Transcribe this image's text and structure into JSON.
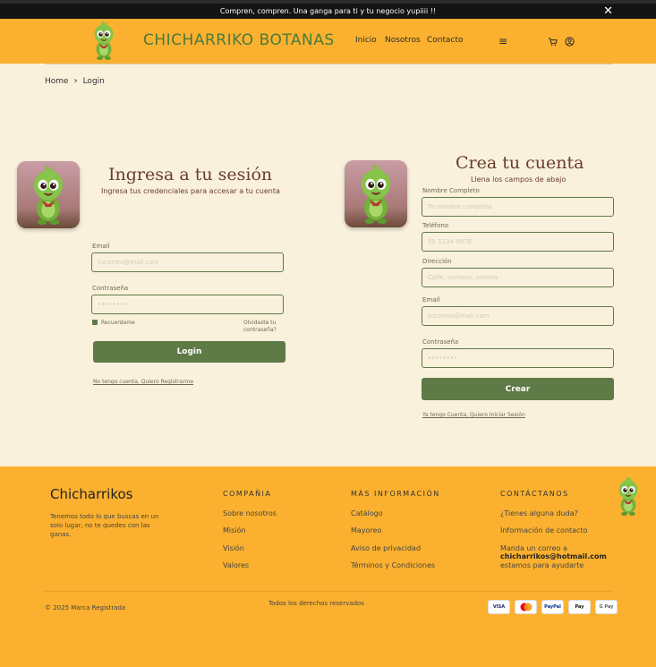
{
  "announcement": {
    "text": "Compren, compren. Una ganga para ti y tu negocio yupiiii !!",
    "close_icon": "close-icon"
  },
  "header": {
    "brand": "CHICHARRIKO BOTANAS",
    "nav": [
      "Inicio",
      "Nosotros",
      "Contacto"
    ],
    "icons": [
      "menu-icon",
      "cart-icon",
      "user-icon"
    ]
  },
  "breadcrumb": {
    "home": "Home",
    "current": "Login"
  },
  "login": {
    "title": "Ingresa a tu sesión",
    "subtitle": "Ingresa tus credenciales para accesar a tu cuenta",
    "email_label": "Email",
    "email_placeholder": "tucorreo@mail.com",
    "password_label": "Contraseña",
    "password_placeholder": "••••••••",
    "remember": "Recuerdame",
    "forgot": "Olvidaste tu contraseña?",
    "button": "Login",
    "no_account": "No tengo cuenta, Quiero Registrarme"
  },
  "register": {
    "title": "Crea tu cuenta",
    "subtitle": "Llena  los campos de abajo",
    "name_label": "Nombre Completo",
    "name_placeholder": "Tu nombre completo",
    "phone_label": "Teléfono",
    "phone_placeholder": "55 1234 5678",
    "address_label": "Dirección",
    "address_placeholder": "Calle, número, colonia",
    "email_label": "Email",
    "email_placeholder": "tucorreo@mail.com",
    "password_label": "Contraseña",
    "password_placeholder": "••••••••",
    "button": "Crear",
    "have_account": "Ya tengo Cuenta, Quiero Iniciar Sesión"
  },
  "footer": {
    "brand": "Chicharrikos",
    "tagline": "Tenemos todo lo que buscas en un solo lugar, no te quedes con las ganas.",
    "company": {
      "title": "COMPAÑIA",
      "items": [
        "Sobre nosotros",
        "Misión",
        "Visión",
        "Valores"
      ]
    },
    "more_info": {
      "title": "MÁS INFORMACIÓN",
      "items": [
        "Catálogo",
        "Mayoreo",
        "Aviso de privacidad",
        "Términos y Condiciones"
      ]
    },
    "contact": {
      "title": "CONTÁCTANOS",
      "items": [
        "¿Tienes alguna duda?",
        "Información de contacto"
      ],
      "mail_prefix": "Manda un correo a",
      "email": "chicharrikos@hotmail.com",
      "mail_suffix": "estamos para ayudarte"
    },
    "copyright": "© 2025 Marca Registrada",
    "rights": "Todos los derechos reservados",
    "payments": [
      "VISA",
      "",
      "PayPal",
      "Pay",
      "G Pay"
    ]
  },
  "colors": {
    "header": "#fbb12f",
    "page_bg": "#f9f1dc",
    "accent_green": "#5e7a47",
    "title_brown": "#6b3c2e"
  }
}
